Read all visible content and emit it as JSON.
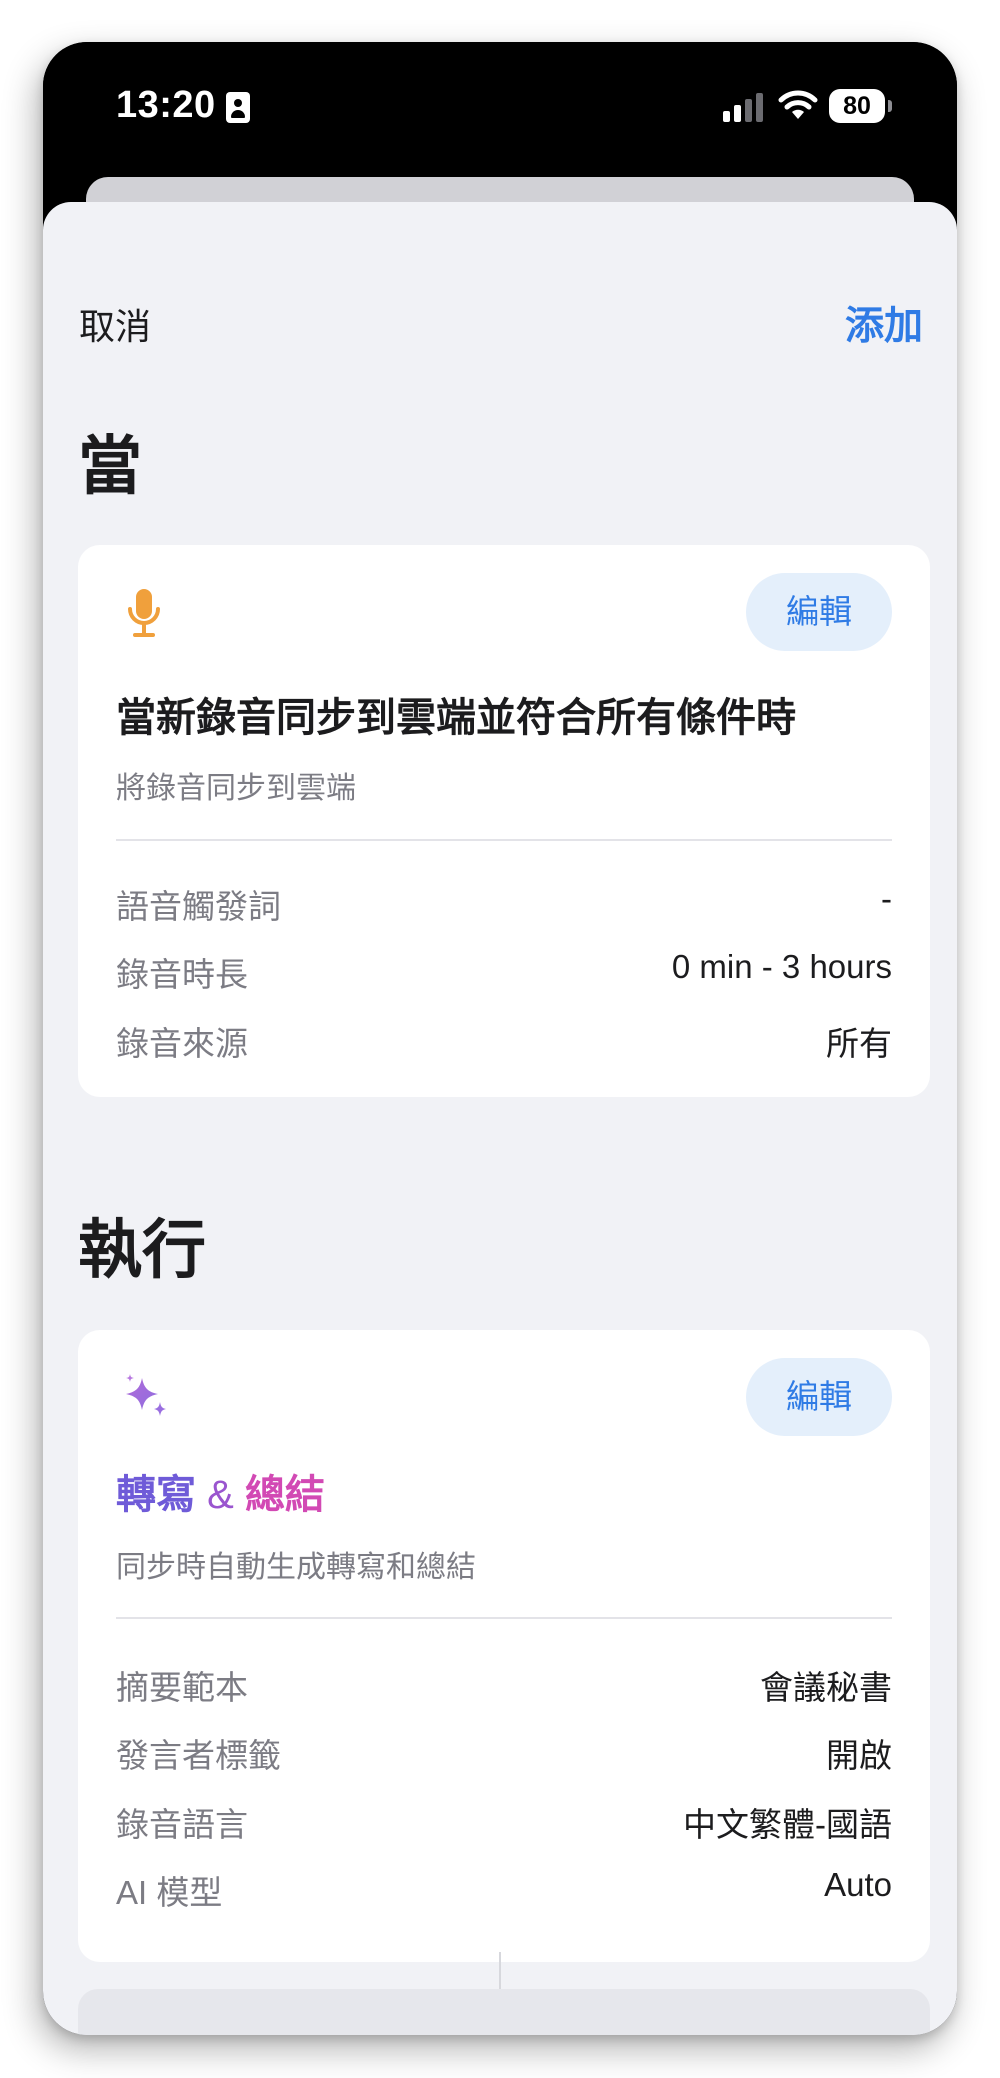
{
  "status_bar": {
    "time": "13:20",
    "battery": "80",
    "icons": [
      "contact-card-icon",
      "cellular-signal-icon",
      "wifi-icon",
      "battery-icon"
    ]
  },
  "nav": {
    "cancel_label": "取消",
    "add_label": "添加"
  },
  "trigger": {
    "section_title": "當",
    "icon": "microphone-icon",
    "edit_label": "編輯",
    "title": "當新錄音同步到雲端並符合所有條件時",
    "subtitle": "將錄音同步到雲端",
    "rows": [
      {
        "label": "語音觸發詞",
        "value": "-"
      },
      {
        "label": "錄音時長",
        "value": "0 min - 3 hours"
      },
      {
        "label": "錄音來源",
        "value": "所有"
      }
    ]
  },
  "action": {
    "section_title": "執行",
    "icon": "sparkles-icon",
    "edit_label": "編輯",
    "title_part1": "轉寫",
    "title_amp": "&",
    "title_part2": "總結",
    "subtitle": "同步時自動生成轉寫和總結",
    "rows": [
      {
        "label": "摘要範本",
        "value": "會議秘書"
      },
      {
        "label": "發言者標籤",
        "value": "開啟"
      },
      {
        "label": "錄音語言",
        "value": "中文繁體-國語"
      },
      {
        "label": "AI 模型",
        "value": "Auto"
      }
    ]
  },
  "colors": {
    "accent": "#2f7be5",
    "edit_bg": "#e4effb",
    "mic": "#f0a03c",
    "gradient_start": "#6f5bd8",
    "gradient_end": "#d249b4"
  }
}
